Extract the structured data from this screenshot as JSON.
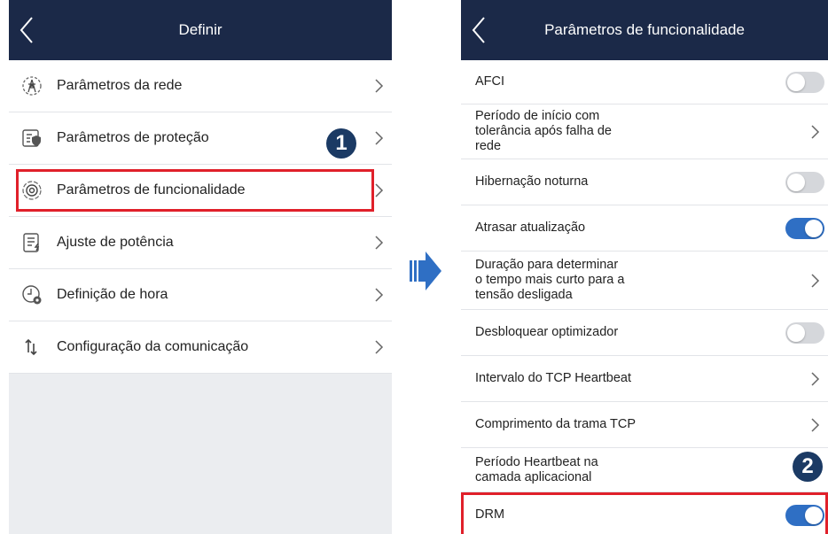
{
  "left": {
    "title": "Definir",
    "items": [
      {
        "label": "Parâmetros da rede",
        "icon": "grid-tower-icon"
      },
      {
        "label": "Parâmetros de proteção",
        "icon": "protection-shield-icon"
      },
      {
        "label": "Parâmetros de funcionalidade",
        "icon": "function-settings-icon"
      },
      {
        "label": "Ajuste de potência",
        "icon": "power-adjust-icon"
      },
      {
        "label": "Definição de hora",
        "icon": "clock-gear-icon"
      },
      {
        "label": "Configuração da comunicação",
        "icon": "communication-arrows-icon"
      }
    ],
    "step_badge": "1"
  },
  "right": {
    "title": "Parâmetros de funcionalidade",
    "items": [
      {
        "label": "AFCI",
        "control": "toggle",
        "on": false
      },
      {
        "label_lines": [
          "Período de início com",
          "tolerância após falha de",
          "rede"
        ],
        "control": "chevron"
      },
      {
        "label": "Hibernação noturna",
        "control": "toggle",
        "on": false
      },
      {
        "label": "Atrasar atualização",
        "control": "toggle",
        "on": true
      },
      {
        "label_lines": [
          "Duração para determinar",
          "o tempo mais curto para a",
          "tensão desligada"
        ],
        "control": "chevron"
      },
      {
        "label": "Desbloquear optimizador",
        "control": "toggle",
        "on": false
      },
      {
        "label": "Intervalo do TCP Heartbeat",
        "control": "chevron"
      },
      {
        "label": "Comprimento da trama TCP",
        "control": "chevron"
      },
      {
        "label_lines": [
          "Período Heartbeat na",
          "camada aplicacional"
        ],
        "control": "none"
      },
      {
        "label": "DRM",
        "control": "toggle",
        "on": true
      }
    ],
    "step_badge": "2"
  },
  "colors": {
    "navbar": "#1b2948",
    "toggle_on": "#2f6fc4",
    "highlight": "#e0202a",
    "badge": "#1b3a64",
    "arrow": "#2f6fc4"
  }
}
